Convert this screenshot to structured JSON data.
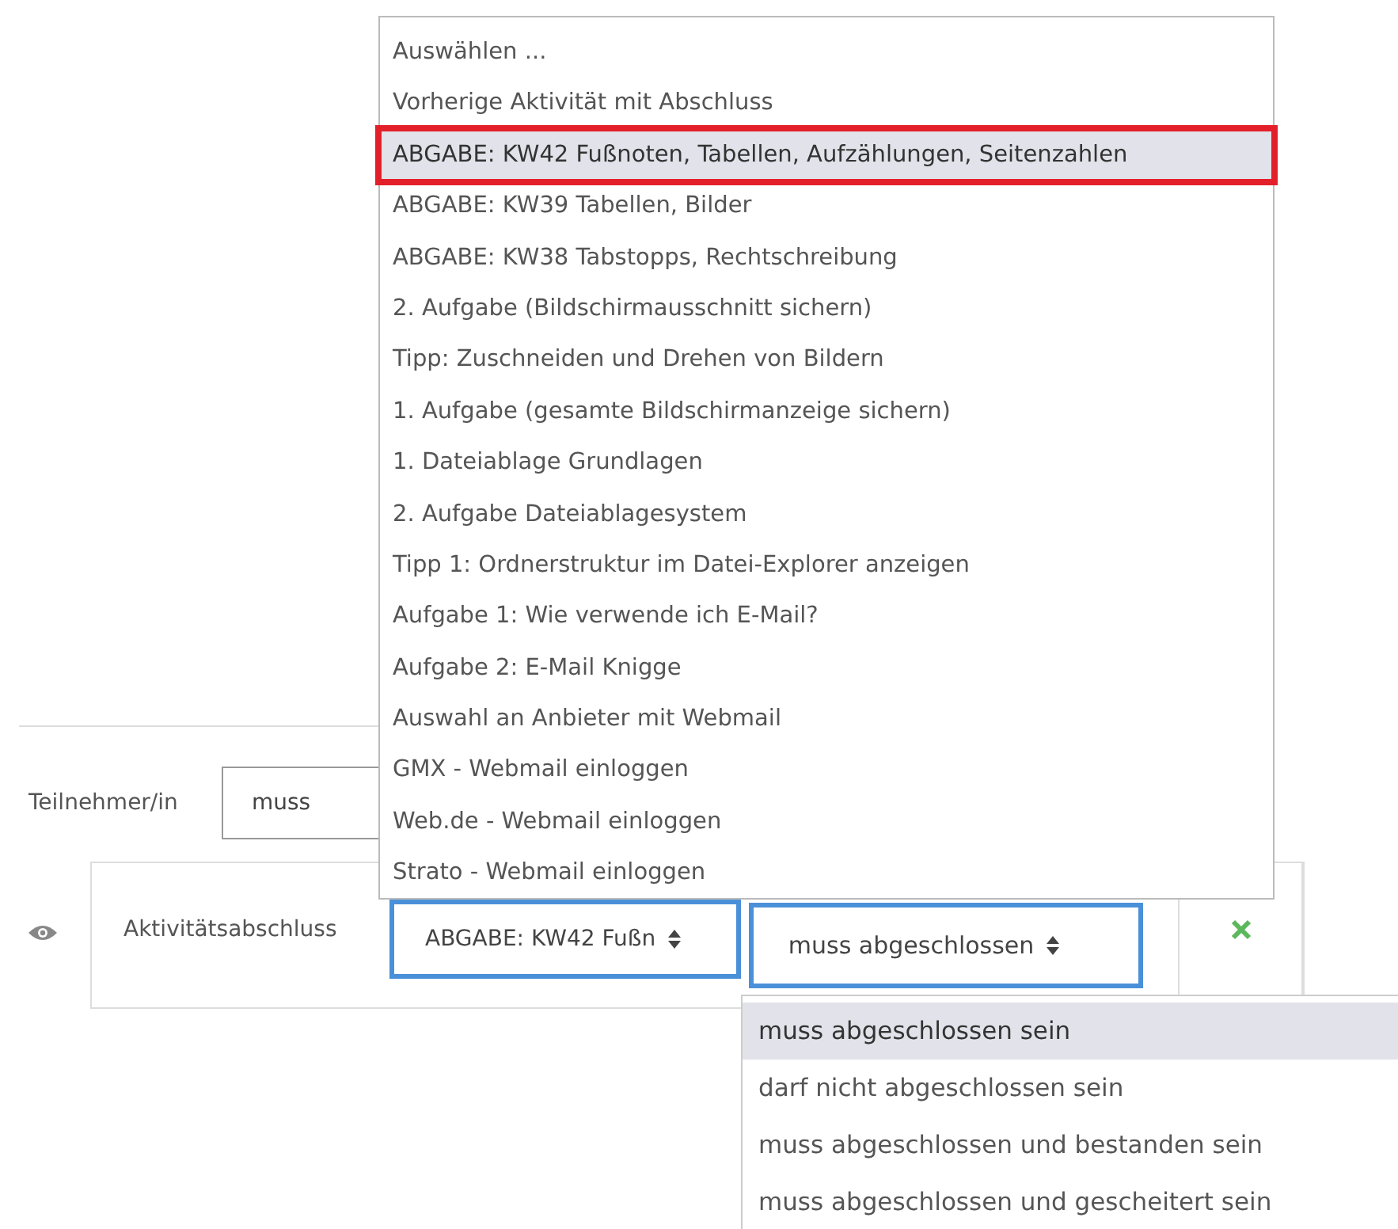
{
  "participant_filter": {
    "label": "Teilnehmer/in",
    "value": "muss"
  },
  "restriction": {
    "label": "Aktivitätsabschluss",
    "activity_value": "ABGABE: KW42 Fußn",
    "condition_value": "muss abgeschlossen"
  },
  "activity_dropdown": [
    {
      "label": "Auswählen ...",
      "selected": false,
      "marked": false
    },
    {
      "label": "Vorherige Aktivität mit Abschluss",
      "selected": false,
      "marked": false
    },
    {
      "label": "ABGABE: KW42 Fußnoten, Tabellen, Aufzählungen, Seitenzahlen",
      "selected": true,
      "marked": true
    },
    {
      "label": "ABGABE: KW39 Tabellen, Bilder",
      "selected": false,
      "marked": false
    },
    {
      "label": "ABGABE: KW38 Tabstopps, Rechtschreibung",
      "selected": false,
      "marked": false
    },
    {
      "label": "2. Aufgabe (Bildschirmausschnitt sichern)",
      "selected": false,
      "marked": false
    },
    {
      "label": "Tipp: Zuschneiden und Drehen von Bildern",
      "selected": false,
      "marked": false
    },
    {
      "label": "1. Aufgabe (gesamte Bildschirmanzeige sichern)",
      "selected": false,
      "marked": false
    },
    {
      "label": "1. Dateiablage Grundlagen",
      "selected": false,
      "marked": false
    },
    {
      "label": "2. Aufgabe Dateiablagesystem",
      "selected": false,
      "marked": false
    },
    {
      "label": "Tipp 1: Ordnerstruktur im Datei-Explorer anzeigen",
      "selected": false,
      "marked": false
    },
    {
      "label": "Aufgabe 1: Wie verwende ich E-Mail?",
      "selected": false,
      "marked": false
    },
    {
      "label": "Aufgabe 2: E-Mail Knigge",
      "selected": false,
      "marked": false
    },
    {
      "label": "Auswahl an Anbieter mit Webmail",
      "selected": false,
      "marked": false
    },
    {
      "label": "GMX - Webmail einloggen",
      "selected": false,
      "marked": false
    },
    {
      "label": "Web.de - Webmail einloggen",
      "selected": false,
      "marked": false
    },
    {
      "label": "Strato - Webmail einloggen",
      "selected": false,
      "marked": false
    }
  ],
  "condition_dropdown": [
    {
      "label": "muss abgeschlossen sein",
      "selected": true
    },
    {
      "label": "darf nicht abgeschlossen sein",
      "selected": false
    },
    {
      "label": "muss abgeschlossen und bestanden sein",
      "selected": false
    },
    {
      "label": "muss abgeschlossen und gescheitert sein",
      "selected": false
    }
  ]
}
